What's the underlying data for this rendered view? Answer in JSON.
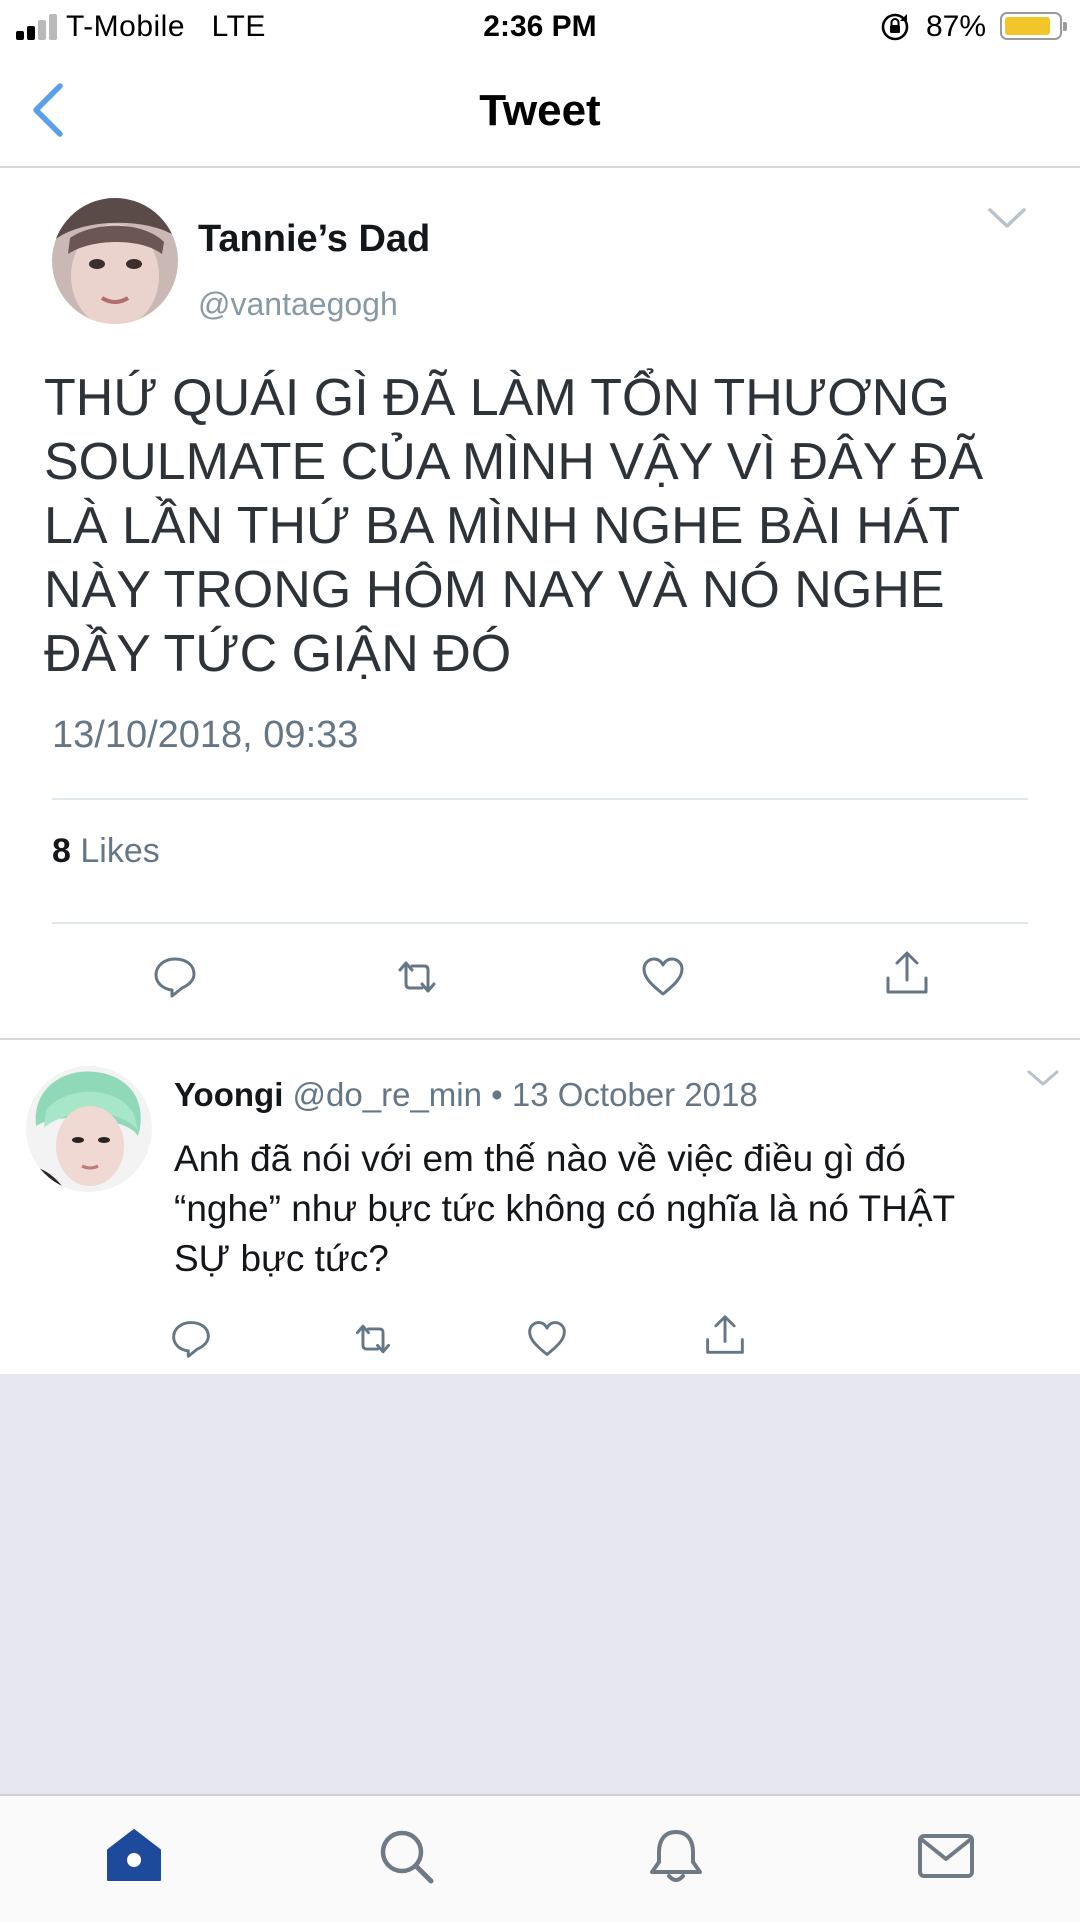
{
  "status_bar": {
    "carrier": "T-Mobile",
    "network": "LTE",
    "time": "2:36 PM",
    "battery_percent": "87%",
    "battery_level": 0.87,
    "battery_color": "#f2c52a"
  },
  "nav": {
    "title": "Tweet",
    "back_icon": "chevron-left-icon",
    "accent": "#5aa0e8"
  },
  "main_tweet": {
    "display_name": "Tannie’s Dad",
    "handle": "@vantaegogh",
    "text": "THỨ QUÁI GÌ ĐÃ LÀM TỔN THƯƠNG SOULMATE CỦA MÌNH VẬY VÌ ĐÂY ĐÃ LÀ LẦN THỨ BA MÌNH NGHE BÀI HÁT NÀY TRONG HÔM NAY VÀ NÓ NGHE ĐẦY TỨC GIẬN ĐÓ",
    "timestamp": "13/10/2018, 09:33",
    "likes_count": "8",
    "likes_label": "Likes",
    "actions": [
      "reply-icon",
      "retweet-icon",
      "heart-icon",
      "share-icon"
    ]
  },
  "reply": {
    "display_name": "Yoongi",
    "handle": "@do_re_min",
    "separator": "•",
    "date": "13 October 2018",
    "text": "Anh đã nói với em thế nào về việc điều gì đó “nghe” như bực tức không có nghĩa là nó THẬT SỰ bực tức?",
    "actions": [
      "reply-icon",
      "retweet-icon",
      "heart-icon",
      "share-icon"
    ]
  },
  "tab_bar": {
    "tabs": [
      "home-icon",
      "search-icon",
      "notifications-icon",
      "messages-icon"
    ],
    "active_color": "#1d4a9b",
    "inactive_color": "#6e7a86"
  }
}
